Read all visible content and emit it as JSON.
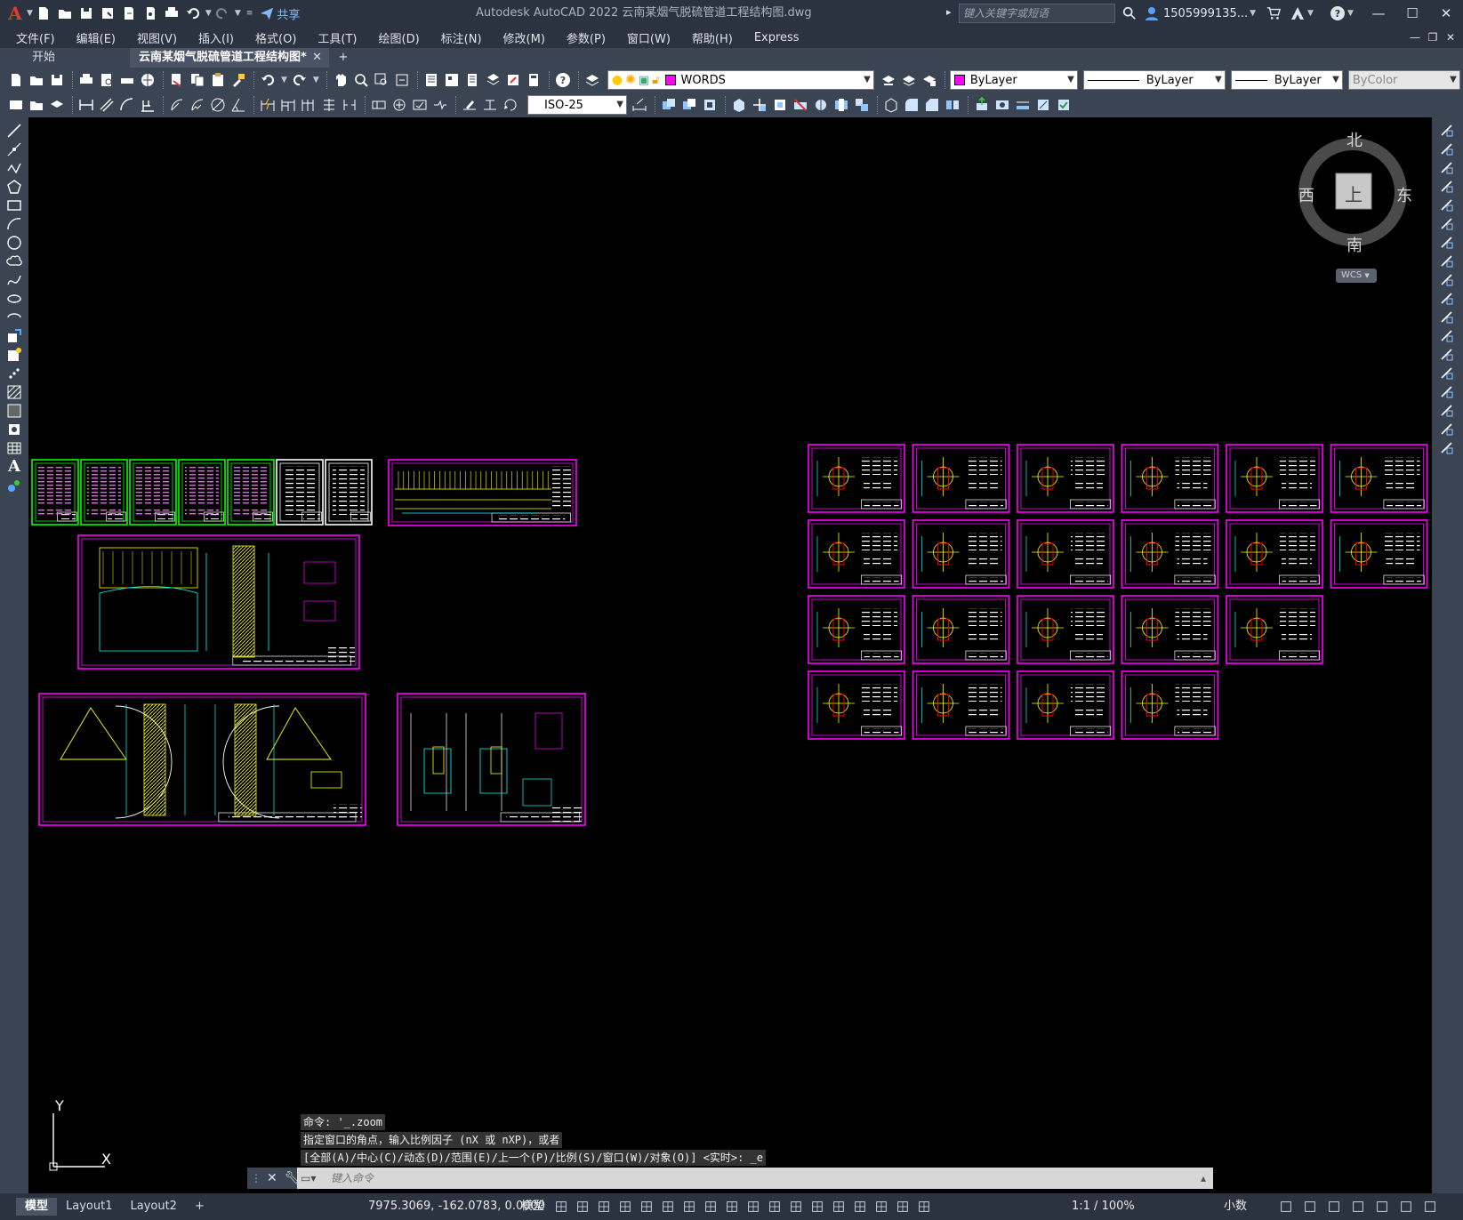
{
  "app": {
    "logo_letter": "A",
    "window_title": "Autodesk AutoCAD 2022    云南某烟气脱硫管道工程结构图.dwg",
    "share_label": "共享",
    "search_placeholder": "键入关键字或短语",
    "user_name": "1505999135...",
    "win_buttons": [
      "—",
      "☐",
      "✕"
    ]
  },
  "menu": [
    "文件(F)",
    "编辑(E)",
    "视图(V)",
    "插入(I)",
    "格式(O)",
    "工具(T)",
    "绘图(D)",
    "标注(N)",
    "修改(M)",
    "参数(P)",
    "窗口(W)",
    "帮助(H)",
    "Express"
  ],
  "tabs": {
    "start": "开始",
    "active": "云南某烟气脱硫管道工程结构图*",
    "close": "✕",
    "add": "+"
  },
  "toolbar": {
    "layer": "WORDS",
    "color": "ByLayer",
    "linetype": "ByLayer",
    "lineweight": "ByLayer",
    "plotstyle": "ByColor",
    "dimstyle": "ISO-25"
  },
  "viewcube": {
    "north": "北",
    "south": "南",
    "east": "东",
    "west": "西",
    "face": "上",
    "wcs": "WCS"
  },
  "ucs": {
    "x": "X",
    "y": "Y"
  },
  "command": {
    "history": [
      "命令: '_.zoom",
      "指定窗口的角点，输入比例因子 (nX 或 nXP)，或者",
      "[全部(A)/中心(C)/动态(D)/范围(E)/上一个(P)/比例(S)/窗口(W)/对象(O)] <实时>: _e"
    ],
    "placeholder": "键入命令"
  },
  "status": {
    "layouts": [
      "模型",
      "Layout1",
      "Layout2",
      "+"
    ],
    "coords": "7975.3069, -162.0783, 0.0000",
    "space": "模型",
    "scale": "1:1 / 100%",
    "units": "小数"
  },
  "colors": {
    "sheet_green": "#00ff00",
    "sheet_magenta": "#ff00ff",
    "sheet_white": "#ffffff",
    "yellow": "#ffff00",
    "cyan": "#00ffff",
    "red": "#ff0000"
  }
}
